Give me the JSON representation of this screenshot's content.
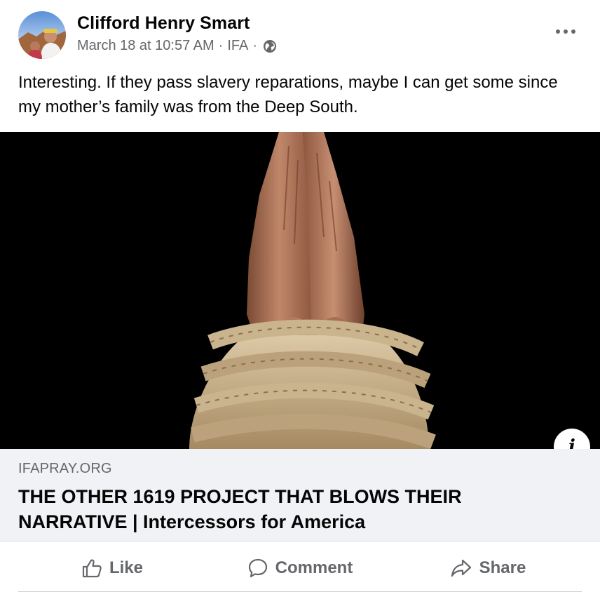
{
  "post": {
    "author": "Clifford Henry Smart",
    "date": "March 18 at 10:57 AM",
    "separator": "·",
    "group": "IFA",
    "audience_icon": "globe-icon",
    "menu_icon": "more-options-icon",
    "text": "Interesting. If they pass slavery reparations, maybe I can get some since my mother’s family was from the Deep South."
  },
  "media": {
    "image_subject": "praying hands bound with rope on black background",
    "info_icon": "i"
  },
  "link": {
    "domain": "IFAPRAY.ORG",
    "title": "THE OTHER 1619 PROJECT THAT BLOWS THEIR NARRATIVE | Intercessors for America"
  },
  "actions": {
    "like": "Like",
    "comment": "Comment",
    "share": "Share"
  },
  "colors": {
    "text_primary": "#050505",
    "text_secondary": "#65676b",
    "link_bg": "#f0f2f5",
    "image_bg": "#000000"
  }
}
